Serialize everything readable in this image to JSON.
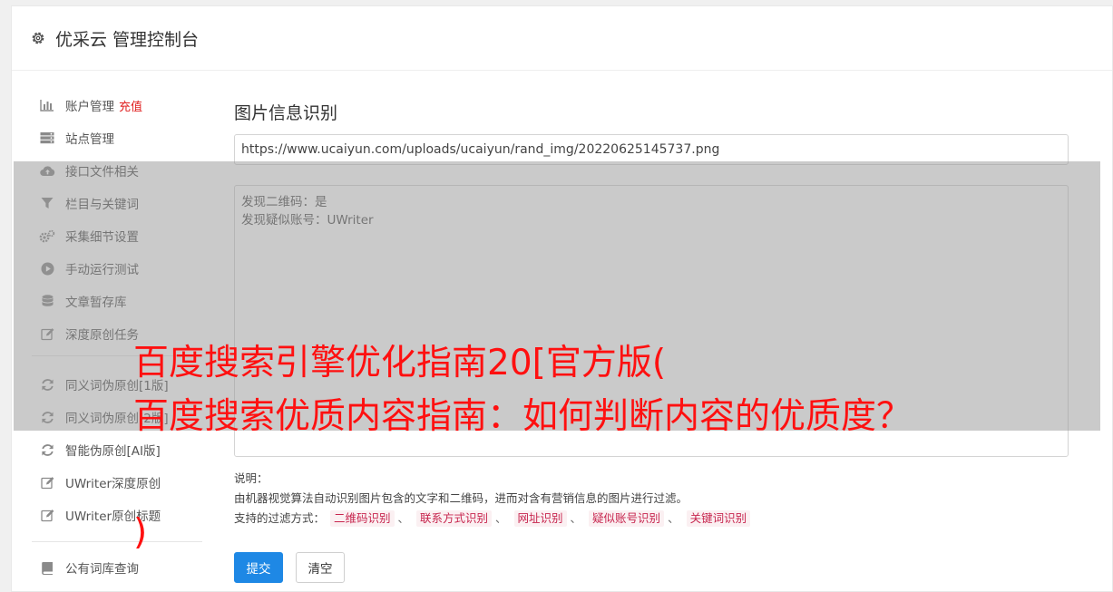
{
  "app": {
    "title": "优采云 管理控制台"
  },
  "sidebar": {
    "items": [
      {
        "label": "账户管理",
        "badge": "充值",
        "icon": "bar-chart-icon"
      },
      {
        "label": "站点管理",
        "icon": "server-icon"
      },
      {
        "label": "接口文件相关",
        "icon": "cloud-upload-icon"
      },
      {
        "label": "栏目与关键词",
        "icon": "filter-icon"
      },
      {
        "label": "采集细节设置",
        "icon": "gears-icon"
      },
      {
        "label": "手动运行测试",
        "icon": "play-circle-icon"
      },
      {
        "label": "文章暂存库",
        "icon": "database-icon"
      },
      {
        "label": "深度原创任务",
        "icon": "edit-icon"
      },
      {
        "label": "同义词伪原创[1版]",
        "icon": "refresh-icon"
      },
      {
        "label": "同义词伪原创[2版]",
        "icon": "refresh-icon"
      },
      {
        "label": "智能伪原创[AI版]",
        "icon": "refresh-icon"
      },
      {
        "label": "UWriter深度原创",
        "icon": "edit-icon"
      },
      {
        "label": "UWriter原创标题",
        "icon": "edit-icon"
      },
      {
        "label": "公有词库查询",
        "icon": "book-icon"
      }
    ]
  },
  "main": {
    "section_title": "图片信息识别",
    "url_value": "https://www.ucaiyun.com/uploads/ucaiyun/rand_img/20220625145737.png",
    "result_lines": [
      "发现二维码：是",
      "发现疑似账号：UWriter"
    ],
    "explain_label": "说明：",
    "explain_text": "由机器视觉算法自动识别图片包含的文字和二维码，进而对含有营销信息的图片进行过滤。",
    "filter_label": "支持的过滤方式：",
    "filter_tags": [
      "二维码识别",
      "联系方式识别",
      "网址识别",
      "疑似账号识别",
      "关键词识别"
    ],
    "filter_sep": "、",
    "submit_label": "提交",
    "clear_label": "清空"
  },
  "overlay_text": {
    "line1": "百度搜索引擎优化指南20[官方版(",
    "line2": "百度搜索优质内容指南：如何判断内容的优质度？",
    "line3": ")"
  },
  "colors": {
    "primary": "#1e88e5",
    "badge_red": "#e02020",
    "tag_text": "#c7254e",
    "tag_bg": "#fbf0f2",
    "overlay_red": "#ff1010"
  }
}
